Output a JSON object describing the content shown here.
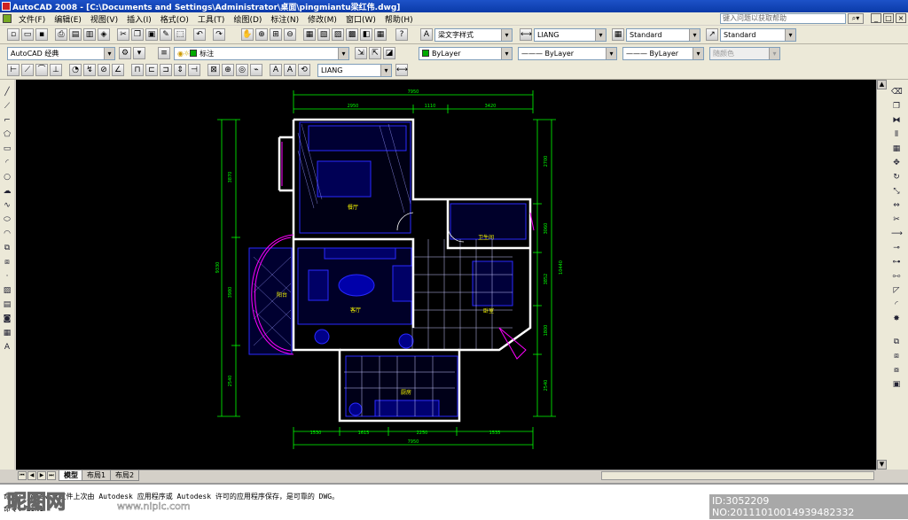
{
  "window": {
    "title": "AutoCAD 2008 - [C:\\Documents and Settings\\Administrator\\桌面\\pingmiantu梁红伟.dwg]",
    "controls": [
      "_",
      "□",
      "×"
    ]
  },
  "menubar": {
    "items": [
      "文件(F)",
      "编辑(E)",
      "视图(V)",
      "插入(I)",
      "格式(O)",
      "工具(T)",
      "绘图(D)",
      "标注(N)",
      "修改(M)",
      "窗口(W)",
      "帮助(H)"
    ],
    "help_search_placeholder": "键入问题以获取帮助"
  },
  "toolbars": {
    "text_style": "梁文字样式",
    "dim_style": "LIANG",
    "table_style": "Standard",
    "multileader_style": "Standard",
    "workspace": "AutoCAD 经典",
    "layer": "标注",
    "dimension_style_2": "LIANG",
    "color": "ByLayer",
    "linetype": "ByLayer",
    "lineweight": "ByLayer",
    "plot_style": "随颜色"
  },
  "drawing": {
    "room_labels": [
      "餐厅",
      "卫生间",
      "客厅",
      "卧室",
      "阳台",
      "厨房"
    ],
    "dimensions_top_total": "7950",
    "dimensions_top": [
      "2950",
      "1110",
      "3420"
    ],
    "dimensions_bottom_total": "7950",
    "dimensions_bottom": [
      "1530",
      "1615",
      "2250",
      "1535"
    ],
    "dimensions_left": [
      "3870",
      "9330",
      "3980",
      "2540"
    ],
    "dimensions_right": [
      "2700",
      "3060",
      "3852",
      "10440",
      "1800",
      "2540"
    ]
  },
  "layout_tabs": [
    "模型",
    "布局1",
    "布局2"
  ],
  "command_line": {
    "line1": "命令: _qnew 此文件上次由 Autodesk 应用程序或 Autodesk 许可的应用程序保存，是可靠的 DWG。",
    "line2": "命令: LIN1"
  },
  "watermark": {
    "logo": "昵图网",
    "url": "www.nipic.com",
    "id": "ID:3052209 NO:20111010014939482332"
  },
  "colors": {
    "canvas_bg": "#000000",
    "dimension_line": "#00ff00",
    "wall": "#ffffff",
    "furniture": "#0000ff",
    "window": "#ff00ff",
    "label": "#ffff00",
    "title_bar": "#0a3aa8"
  }
}
